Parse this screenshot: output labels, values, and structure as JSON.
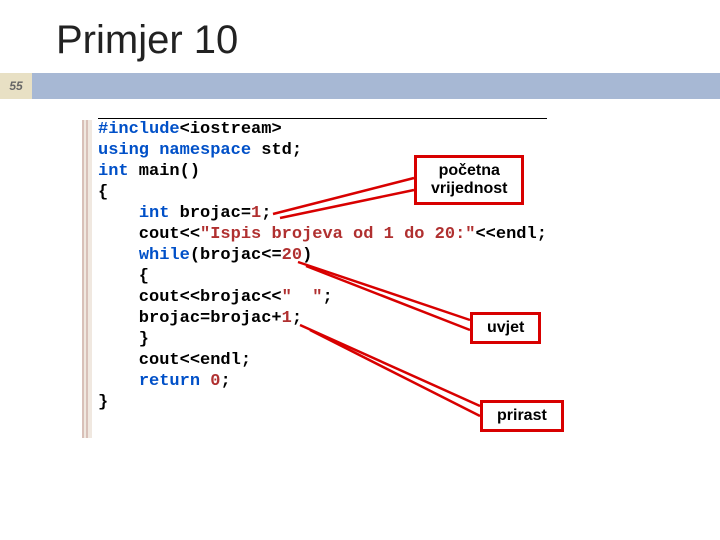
{
  "title": "Primjer 10",
  "page_number": "55",
  "callouts": {
    "initial": "početna\nvrijednost",
    "condition": "uvjet",
    "increment": "prirast"
  },
  "code": {
    "l1a": "#include",
    "l1b": "<iostream>",
    "l2a": "using",
    "l2b": " ",
    "l2c": "namespace",
    "l2d": " std;",
    "l3a": "int",
    "l3b": " main()",
    "l4": "{",
    "l5a": "    ",
    "l5b": "int",
    "l5c": " brojac=",
    "l5d": "1",
    "l5e": ";",
    "l6a": "    cout<<",
    "l6b": "\"Ispis brojeva od 1 do 20:\"",
    "l6c": "<<endl;",
    "l7a": "    ",
    "l7b": "while",
    "l7c": "(brojac<=",
    "l7d": "20",
    "l7e": ")",
    "l8": "    {",
    "l9a": "    cout<<brojac<<",
    "l9b": "\"  \"",
    "l9c": ";",
    "l10a": "    brojac=brojac+",
    "l10b": "1",
    "l10c": ";",
    "l11": "    }",
    "l12": "    cout<<endl;",
    "l13a": "    ",
    "l13b": "return",
    "l13c": " ",
    "l13d": "0",
    "l13e": ";",
    "l14": "}"
  }
}
